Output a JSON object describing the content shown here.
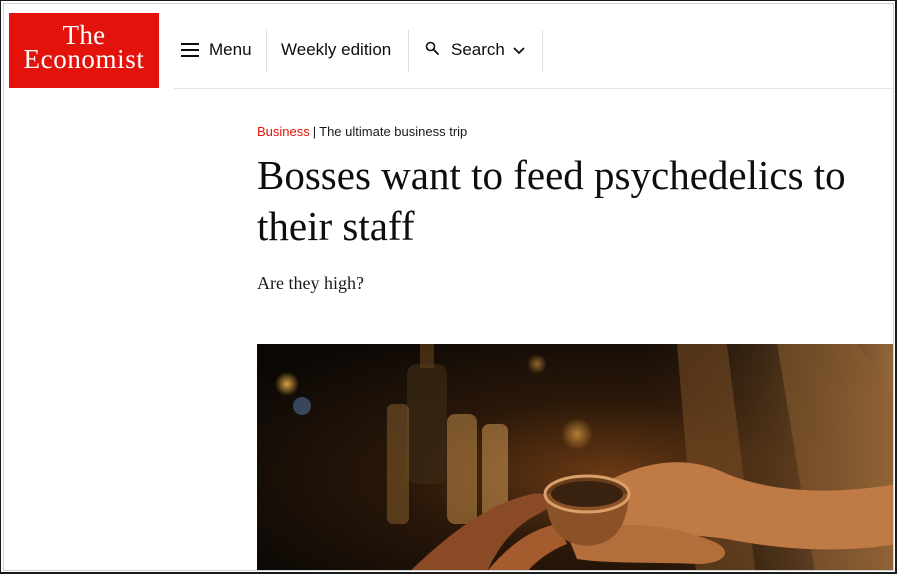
{
  "logo": {
    "line1": "The",
    "line2": "Economist"
  },
  "nav": {
    "menu_label": "Menu",
    "weekly_label": "Weekly edition",
    "search_label": "Search"
  },
  "article": {
    "section": "Business",
    "separator": "|",
    "series": "The ultimate business trip",
    "headline": "Bosses want to feed psychedelics to their staff",
    "standfirst": "Are they high?"
  },
  "colors": {
    "brand_red": "#e3120b"
  },
  "icons": [
    "menu-icon",
    "search-icon",
    "chevron-down-icon"
  ]
}
